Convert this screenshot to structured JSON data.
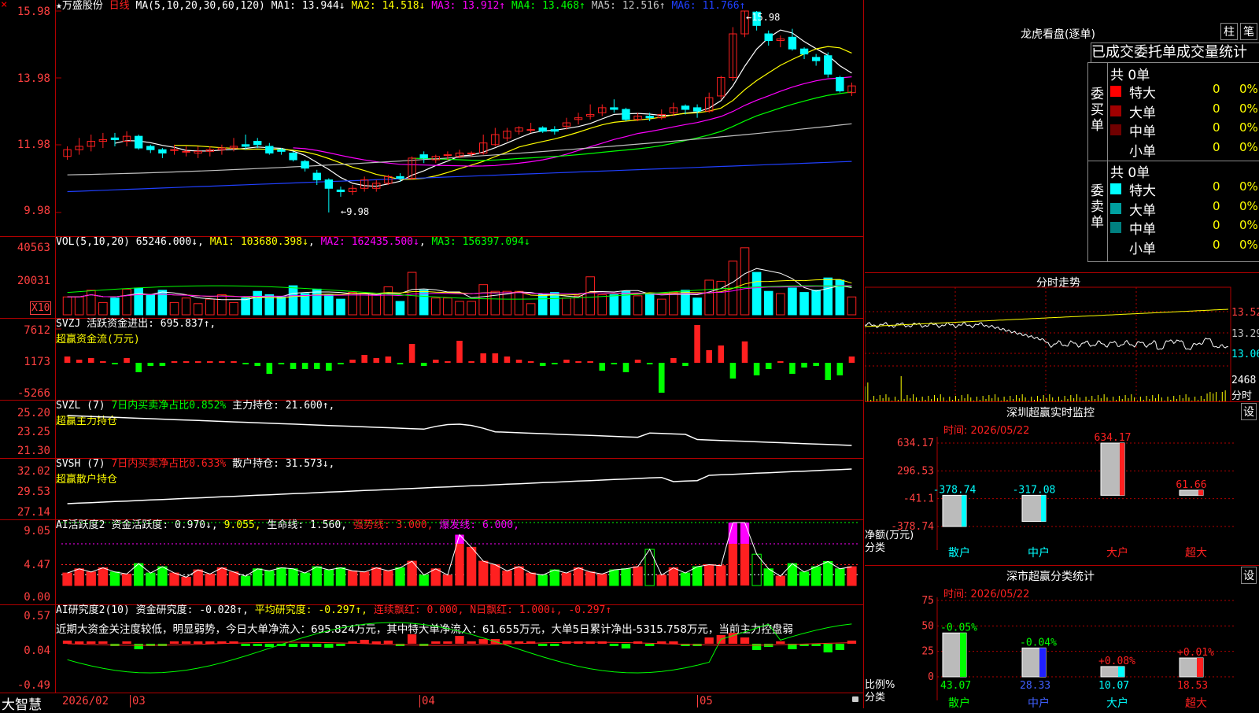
{
  "colors": {
    "up": "#ff2020",
    "down": "#00ffff",
    "ma1": "#ffffff",
    "ma2": "#ffff00",
    "ma3": "#ff00ff",
    "ma4": "#00ff00",
    "ma5": "#c0c0c0",
    "ma6": "#2040ff",
    "grid": "#b00000",
    "label": "#ff4040"
  },
  "top_left": {
    "marker": "×"
  },
  "main": {
    "star_title": "★万盛股份",
    "period": "日线",
    "ma_params": "MA(5,10,20,30,60,120)",
    "ma1": "MA1: 13.944↓",
    "ma2": "MA2: 14.518↓",
    "ma3": "MA3: 13.912↑",
    "ma4": "MA4: 13.468↑",
    "ma5": "MA5: 12.516↑",
    "ma6": "MA6: 11.766↑",
    "yticks": [
      "15.98",
      "13.98",
      "11.98",
      "9.98"
    ],
    "high_label": "15.98",
    "low_label": "9.98",
    "candles": [
      [
        11.65,
        11.85,
        11.95,
        11.55
      ],
      [
        11.85,
        11.95,
        12.2,
        11.7
      ],
      [
        11.95,
        12.1,
        12.3,
        11.8
      ],
      [
        12.1,
        12.15,
        12.35,
        11.9
      ],
      [
        12.2,
        12.15,
        12.35,
        11.95
      ],
      [
        12.1,
        12.25,
        12.4,
        11.95
      ],
      [
        12.25,
        11.9,
        12.3,
        11.85
      ],
      [
        11.95,
        11.85,
        12.0,
        11.75
      ],
      [
        11.85,
        11.75,
        11.9,
        11.6
      ],
      [
        11.85,
        11.85,
        12.0,
        11.7
      ],
      [
        11.8,
        11.8,
        11.95,
        11.65
      ],
      [
        11.75,
        11.8,
        11.95,
        11.6
      ],
      [
        11.8,
        11.85,
        11.95,
        11.65
      ],
      [
        11.85,
        11.9,
        12.0,
        11.7
      ],
      [
        11.9,
        11.95,
        12.2,
        11.8
      ],
      [
        12.0,
        11.95,
        12.3,
        11.85
      ],
      [
        12.1,
        12.0,
        12.2,
        11.9
      ],
      [
        11.95,
        11.75,
        12.05,
        11.7
      ],
      [
        11.85,
        11.8,
        11.9,
        11.7
      ],
      [
        11.75,
        11.55,
        11.8,
        11.5
      ],
      [
        11.5,
        11.3,
        11.55,
        11.2
      ],
      [
        11.15,
        10.95,
        11.25,
        10.8
      ],
      [
        10.95,
        10.7,
        11.0,
        9.98
      ],
      [
        10.65,
        10.6,
        10.75,
        10.45
      ],
      [
        10.6,
        10.7,
        10.8,
        10.5
      ],
      [
        10.7,
        10.95,
        11.05,
        10.6
      ],
      [
        10.7,
        10.85,
        10.95,
        10.6
      ],
      [
        10.85,
        11.05,
        11.1,
        10.8
      ],
      [
        11.05,
        11.0,
        11.15,
        10.9
      ],
      [
        11.0,
        11.6,
        11.65,
        10.95
      ],
      [
        11.7,
        11.6,
        11.8,
        11.45
      ],
      [
        11.55,
        11.65,
        11.7,
        11.45
      ],
      [
        11.7,
        11.7,
        11.8,
        11.55
      ],
      [
        11.65,
        11.75,
        11.85,
        11.6
      ],
      [
        11.75,
        11.75,
        11.8,
        11.65
      ],
      [
        11.75,
        12.05,
        12.3,
        11.7
      ],
      [
        12.0,
        12.3,
        12.5,
        11.95
      ],
      [
        12.2,
        12.4,
        12.5,
        12.1
      ],
      [
        12.4,
        12.5,
        12.55,
        12.3
      ],
      [
        12.45,
        12.45,
        12.65,
        12.35
      ],
      [
        12.5,
        12.4,
        12.55,
        12.35
      ],
      [
        12.45,
        12.4,
        12.55,
        12.3
      ],
      [
        12.55,
        12.65,
        12.8,
        12.45
      ],
      [
        12.75,
        12.8,
        12.95,
        12.6
      ],
      [
        12.85,
        12.9,
        13.2,
        12.75
      ],
      [
        12.95,
        13.1,
        13.2,
        12.85
      ],
      [
        13.1,
        13.05,
        13.35,
        12.95
      ],
      [
        13.05,
        12.75,
        13.1,
        12.7
      ],
      [
        12.75,
        12.85,
        12.95,
        12.7
      ],
      [
        12.85,
        12.8,
        12.95,
        12.7
      ],
      [
        12.8,
        12.9,
        13.05,
        12.75
      ],
      [
        12.95,
        13.1,
        13.25,
        12.85
      ],
      [
        13.15,
        13.05,
        13.2,
        12.9
      ],
      [
        13.1,
        13.0,
        13.2,
        12.8
      ],
      [
        13.0,
        13.4,
        13.55,
        12.95
      ],
      [
        13.45,
        14.0,
        14.05,
        13.35
      ],
      [
        14.0,
        15.3,
        15.5,
        13.9
      ],
      [
        15.3,
        15.98,
        15.98,
        15.2
      ],
      [
        15.95,
        15.55,
        15.98,
        15.4
      ],
      [
        15.3,
        15.1,
        15.4,
        14.95
      ],
      [
        15.1,
        15.15,
        15.25,
        14.9
      ],
      [
        15.2,
        14.85,
        15.45,
        14.8
      ],
      [
        14.85,
        14.7,
        14.9,
        14.55
      ],
      [
        14.6,
        14.5,
        14.7,
        14.35
      ],
      [
        14.65,
        14.1,
        14.75,
        14.0
      ],
      [
        14.0,
        13.6,
        14.05,
        13.55
      ],
      [
        13.55,
        13.75,
        13.85,
        13.45
      ]
    ]
  },
  "vol": {
    "title": "VOL(5,10,20)",
    "v": "65246.000↓",
    "ma1": "MA1: 103680.398↓",
    "ma2": "MA2: 162435.500↓",
    "ma3": "MA3: 156397.094↓",
    "yticks": [
      "40563",
      "20031"
    ],
    "unit": "X10"
  },
  "svzj": {
    "title": "SVZJ",
    "text": "活跃资金进出: 695.837↑,",
    "sub": "超赢资金流(万元)",
    "yticks": [
      "7612",
      "1173",
      "-5266"
    ]
  },
  "svzl": {
    "title": "SVZL (7)",
    "text1": "7日内买卖净占比0.852%",
    "text2": "主力持仓: 21.600↑,",
    "sub": "超赢主力持仓",
    "yticks": [
      "25.20",
      "23.25",
      "21.30"
    ]
  },
  "svsh": {
    "title": "SVSH (7)",
    "text1": "7日内买卖净占比0.633%",
    "text2": "散户持仓: 31.573↓,",
    "sub": "超赢散户持仓",
    "yticks": [
      "32.02",
      "29.53",
      "27.14"
    ]
  },
  "ai2": {
    "title": "AI活跃度2",
    "t1": "资金活跃度: 0.970↓,",
    "t2": "9.055,",
    "t3": "生命线: 1.560,",
    "t4": "强势线: 3.000,",
    "t5": "爆发线: 6.000,",
    "yticks": [
      "9.05",
      "4.47",
      "0.00"
    ]
  },
  "ai_res": {
    "title": "AI研究度2(10)",
    "t1": "资金研究度: -0.028↑,",
    "t2": "平均研究度: -0.297↑,",
    "t3": "连续飘红: 0.000,",
    "t4": "N日飘红: 1.000↓,",
    "t5": "-0.297↑",
    "summary": "近期大资金关注度较低，明显弱势，今日大单净流入：695.824万元，其中特大单净流入：61.655万元，大单5日累计净出-5315.758万元，当前主力控盘弱",
    "yticks": [
      "0.57",
      "0.04",
      "-0.49"
    ]
  },
  "bottom": {
    "brand": "大智慧",
    "date": "2026/02",
    "m3": "03",
    "m4": "04",
    "m5": "05"
  },
  "lhb": {
    "title": "龙虎看盘(逐单)",
    "btn1": "柱",
    "btn2": "笔",
    "tab": "已成交委托单成交量统计",
    "buy": {
      "side": "委买单",
      "total": "共 0单",
      "rows": [
        {
          "label": "特大",
          "v": "0",
          "p": "0%",
          "c": "#ff0000"
        },
        {
          "label": "大单",
          "v": "0",
          "p": "0%",
          "c": "#a00000"
        },
        {
          "label": "中单",
          "v": "0",
          "p": "0%",
          "c": "#700000"
        },
        {
          "label": "小单",
          "v": "0",
          "p": "0%",
          "c": ""
        }
      ]
    },
    "sell": {
      "side": "委卖单",
      "total": "共 0单",
      "rows": [
        {
          "label": "特大",
          "v": "0",
          "p": "0%",
          "c": "#00ffff"
        },
        {
          "label": "大单",
          "v": "0",
          "p": "0%",
          "c": "#00a0a0"
        },
        {
          "label": "中单",
          "v": "0",
          "p": "0%",
          "c": "#008080"
        },
        {
          "label": "小单",
          "v": "0",
          "p": "0%",
          "c": ""
        }
      ]
    }
  },
  "intraday": {
    "title": "分时走势",
    "yticks": [
      "13.52",
      "13.29",
      "13.06"
    ],
    "vol_tick": "2468",
    "vol_label": "分时"
  },
  "monitor": {
    "title": "深圳超赢实时监控",
    "set": "设",
    "time": "时间: 2026/05/22",
    "yticks": [
      "634.17",
      "296.53",
      "-41.1",
      "-378.74"
    ],
    "yl1": "净额(万元)",
    "yl2": "分类",
    "bars": [
      {
        "cat": "散户",
        "value": -378.74,
        "label": "-378.74"
      },
      {
        "cat": "中户",
        "value": -317.08,
        "label": "-317.08"
      },
      {
        "cat": "大户",
        "value": 634.17,
        "label": "634.17"
      },
      {
        "cat": "超大",
        "value": 61.66,
        "label": "61.66"
      }
    ]
  },
  "classify": {
    "title": "深市超赢分类统计",
    "set": "设",
    "time": "时间: 2026/05/22",
    "yticks": [
      "75",
      "50",
      "25",
      "0"
    ],
    "yl1": "比例%",
    "yl2": "分类",
    "bars": [
      {
        "cat": "散户",
        "value": 43.07,
        "label": "43.07",
        "delta": "-0.05%",
        "color": "#00ff00"
      },
      {
        "cat": "中户",
        "value": 28.33,
        "label": "28.33",
        "delta": "-0.04%",
        "color": "#2020ff"
      },
      {
        "cat": "大户",
        "value": 10.07,
        "label": "10.07",
        "delta": "+0.08%",
        "color": "#00ffff"
      },
      {
        "cat": "超大",
        "value": 18.53,
        "label": "18.53",
        "delta": "+0.01%",
        "color": "#ff2020"
      }
    ]
  }
}
